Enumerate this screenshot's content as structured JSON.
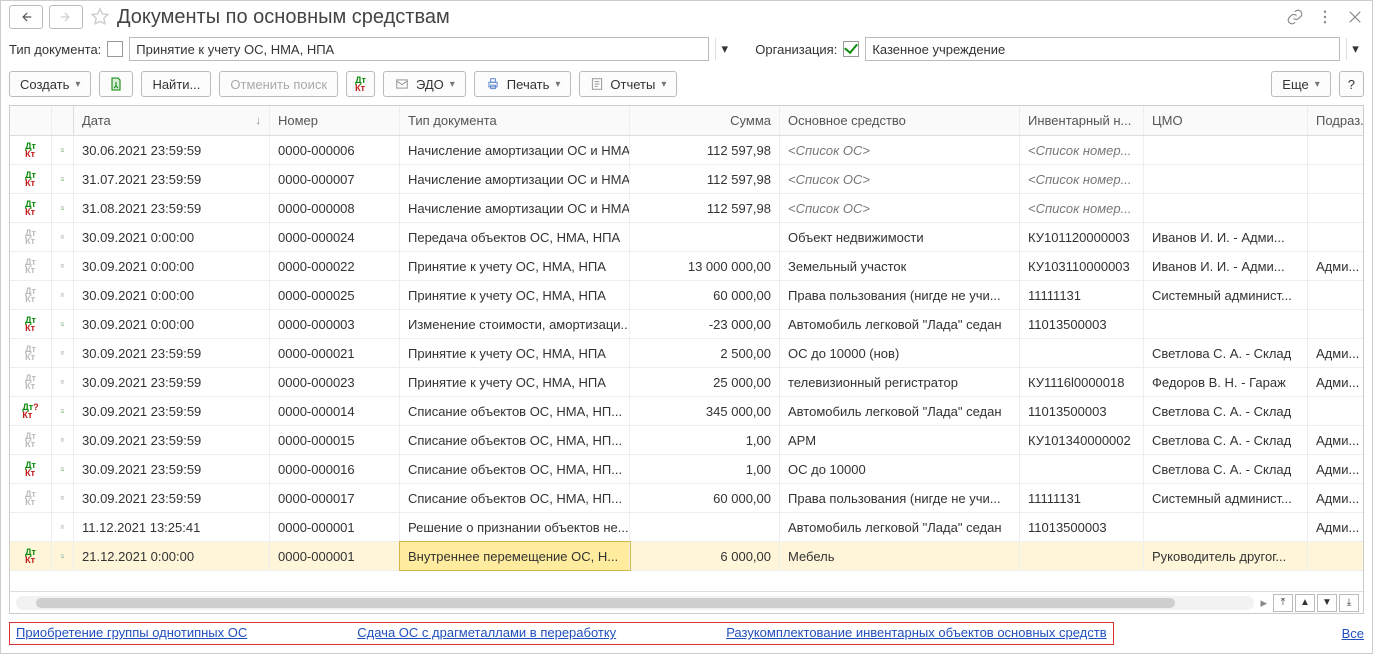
{
  "header": {
    "title": "Документы по основным средствам"
  },
  "filter": {
    "docTypeLabel": "Тип документа:",
    "docTypeValue": "Принятие к учету ОС, НМА, НПА",
    "orgLabel": "Организация:",
    "orgValue": "Казенное учреждение"
  },
  "toolbar": {
    "create": "Создать",
    "find": "Найти...",
    "cancelSearch": "Отменить поиск",
    "edo": "ЭДО",
    "print": "Печать",
    "reports": "Отчеты",
    "more": "Еще"
  },
  "columns": {
    "date": "Дата",
    "number": "Номер",
    "docType": "Тип документа",
    "sum": "Сумма",
    "asset": "Основное средство",
    "inv": "Инвентарный н...",
    "cmo": "ЦМО",
    "dept": "Подраз..."
  },
  "rows": [
    {
      "m1": "dtkt-g",
      "m2": "post",
      "date": "30.06.2021 23:59:59",
      "num": "0000-000006",
      "type": "Начисление амортизации ОС и НМА",
      "sum": "112 597,98",
      "asset": "<Список ОС>",
      "assetItalic": true,
      "inv": "<Список номер...",
      "invItalic": true,
      "cmo": "",
      "dept": ""
    },
    {
      "m1": "dtkt-g",
      "m2": "post",
      "date": "31.07.2021 23:59:59",
      "num": "0000-000007",
      "type": "Начисление амортизации ОС и НМА",
      "sum": "112 597,98",
      "asset": "<Список ОС>",
      "assetItalic": true,
      "inv": "<Список номер...",
      "invItalic": true,
      "cmo": "",
      "dept": ""
    },
    {
      "m1": "dtkt-g",
      "m2": "post",
      "date": "31.08.2021 23:59:59",
      "num": "0000-000008",
      "type": "Начисление амортизации ОС и НМА",
      "sum": "112 597,98",
      "asset": "<Список ОС>",
      "assetItalic": true,
      "inv": "<Список номер...",
      "invItalic": true,
      "cmo": "",
      "dept": ""
    },
    {
      "m1": "dtkt-0",
      "m2": "doc",
      "date": "30.09.2021 0:00:00",
      "num": "0000-000024",
      "type": "Передача объектов ОС, НМА, НПА",
      "sum": "",
      "asset": "Объект недвижимости",
      "inv": "КУ101120000003",
      "cmo": "Иванов И. И. - Адми...",
      "dept": ""
    },
    {
      "m1": "dtkt-0",
      "m2": "doc",
      "date": "30.09.2021 0:00:00",
      "num": "0000-000022",
      "type": "Принятие к учету ОС, НМА, НПА",
      "sum": "13 000 000,00",
      "asset": "Земельный участок",
      "inv": "КУ103110000003",
      "cmo": "Иванов И. И. - Адми...",
      "dept": "Адми..."
    },
    {
      "m1": "dtkt-0",
      "m2": "doc",
      "date": "30.09.2021 0:00:00",
      "num": "0000-000025",
      "type": "Принятие к учету ОС, НМА, НПА",
      "sum": "60 000,00",
      "asset": "Права пользования  (нигде не учи...",
      "inv": "11111131",
      "cmo": "Системный админист...",
      "dept": ""
    },
    {
      "m1": "dtkt-g",
      "m2": "post",
      "date": "30.09.2021 0:00:00",
      "num": "0000-000003",
      "type": "Изменение стоимости, амортизаци...",
      "sum": "-23 000,00",
      "asset": "Автомобиль легковой \"Лада\" седан",
      "inv": "11013500003",
      "cmo": "",
      "dept": ""
    },
    {
      "m1": "dtkt-0",
      "m2": "doc",
      "date": "30.09.2021 23:59:59",
      "num": "0000-000021",
      "type": "Принятие к учету ОС, НМА, НПА",
      "sum": "2 500,00",
      "asset": "ОС до 10000 (нов)",
      "inv": "",
      "cmo": "Светлова С. А. - Склад",
      "dept": "Адми..."
    },
    {
      "m1": "dtkt-0",
      "m2": "doc",
      "date": "30.09.2021 23:59:59",
      "num": "0000-000023",
      "type": "Принятие к учету ОС, НМА, НПА",
      "sum": "25 000,00",
      "asset": "телевизионный регистратор",
      "inv": "КУ1116l0000018",
      "cmo": "Федоров В. Н. - Гараж",
      "dept": "Адми..."
    },
    {
      "m1": "dtkt-q",
      "m2": "post",
      "date": "30.09.2021 23:59:59",
      "num": "0000-000014",
      "type": "Списание объектов ОС, НМА, НП...",
      "sum": "345 000,00",
      "asset": "Автомобиль легковой \"Лада\" седан",
      "inv": "11013500003",
      "cmo": "Светлова С. А. - Склад",
      "dept": ""
    },
    {
      "m1": "dtkt-0",
      "m2": "doc",
      "date": "30.09.2021 23:59:59",
      "num": "0000-000015",
      "type": "Списание объектов ОС, НМА, НП...",
      "sum": "1,00",
      "asset": "АРМ",
      "inv": "КУ101340000002",
      "cmo": "Светлова С. А. - Склад",
      "dept": "Адми..."
    },
    {
      "m1": "dtkt-g",
      "m2": "post",
      "date": "30.09.2021 23:59:59",
      "num": "0000-000016",
      "type": "Списание объектов ОС, НМА, НП...",
      "sum": "1,00",
      "asset": "ОС до 10000",
      "inv": "",
      "cmo": "Светлова С. А. - Склад",
      "dept": "Адми..."
    },
    {
      "m1": "dtkt-0",
      "m2": "doc",
      "date": "30.09.2021 23:59:59",
      "num": "0000-000017",
      "type": "Списание объектов ОС, НМА, НП...",
      "sum": "60 000,00",
      "asset": "Права пользования  (нигде не учи...",
      "inv": "11111131",
      "cmo": "Системный админист...",
      "dept": "Адми..."
    },
    {
      "m1": "",
      "m2": "doc",
      "date": "11.12.2021 13:25:41",
      "num": "0000-000001",
      "type": "Решение о признании объектов не...",
      "sum": "",
      "asset": "Автомобиль легковой \"Лада\" седан",
      "inv": "11013500003",
      "cmo": "",
      "dept": "Адми..."
    },
    {
      "m1": "dtkt-g",
      "m2": "post",
      "date": "21.12.2021 0:00:00",
      "num": "0000-000001",
      "type": "Внутреннее перемещение ОС, Н...",
      "sum": "6 000,00",
      "asset": "Мебель",
      "inv": "",
      "cmo": "Руководитель другог...",
      "dept": "",
      "hl": true
    }
  ],
  "links": {
    "l1": "Приобретение группы однотипных ОС",
    "l2": "Сдача ОС с драгметаллами в переработку",
    "l3": "Разукомплектование инвентарных объектов основных средств",
    "all": "Все"
  }
}
